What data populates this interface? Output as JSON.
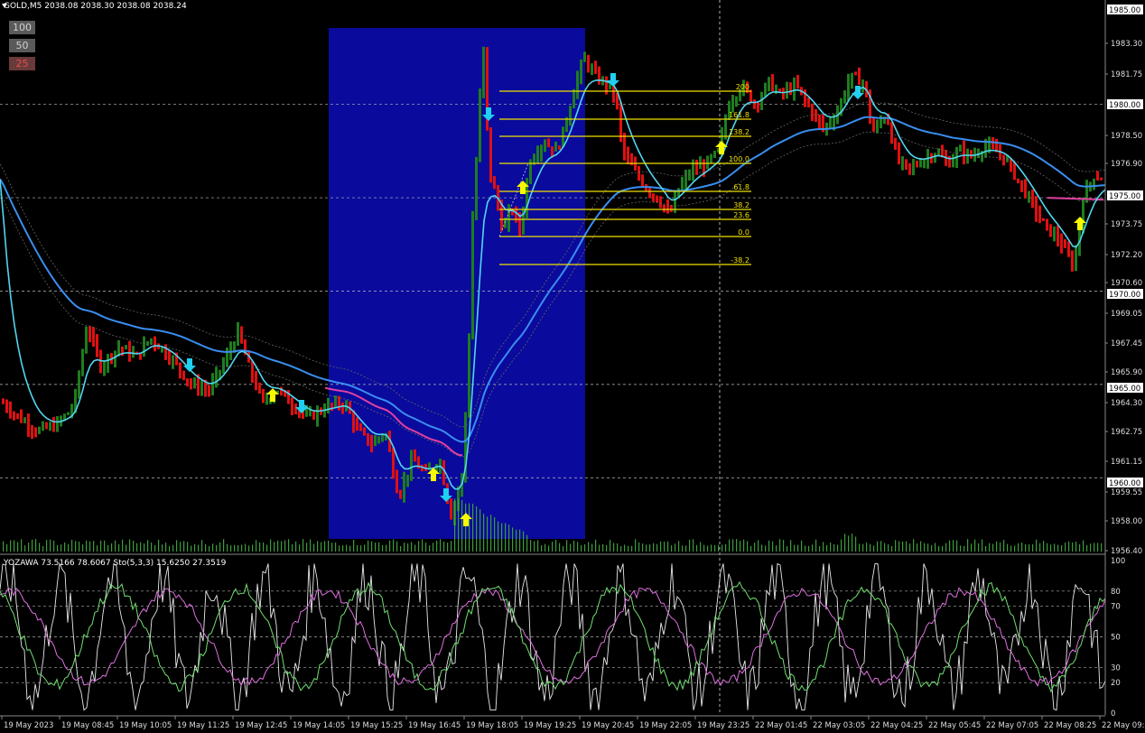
{
  "header": {
    "title": "GOLD,M5  2038.08 2038.30 2038.08 2038.24",
    "indicator_title": "YOZAWA 73.5166 78.6067  Sto(5,3,3) 15.6250 27.3519"
  },
  "zoom_buttons": [
    "100",
    "50",
    "25"
  ],
  "price_axis": {
    "labels": [
      "1985.00",
      "1983.30",
      "1981.75",
      "1980.00",
      "1978.50",
      "1976.90",
      "1975.00",
      "1973.75",
      "1972.20",
      "1970.60",
      "1970.00",
      "1969.05",
      "1967.45",
      "1965.90",
      "1965.00",
      "1964.30",
      "1962.75",
      "1961.15",
      "1960.00",
      "1959.55",
      "1958.00",
      "1956.40"
    ],
    "highlight": [
      "1985.00",
      "1980.00",
      "1975.00",
      "1970.00",
      "1965.00",
      "1960.00"
    ]
  },
  "indicator_axis": {
    "labels": [
      "100",
      "80",
      "70",
      "50",
      "30",
      "20",
      "0"
    ]
  },
  "time_axis": {
    "labels": [
      "19 May 2023",
      "19 May 08:45",
      "19 May 10:05",
      "19 May 11:25",
      "19 May 12:45",
      "19 May 14:05",
      "19 May 15:25",
      "19 May 16:45",
      "19 May 18:05",
      "19 May 19:25",
      "19 May 20:45",
      "19 May 22:05",
      "19 May 23:25",
      "22 May 01:45",
      "22 May 03:05",
      "22 May 04:25",
      "22 May 05:45",
      "22 May 07:05",
      "22 May 08:25",
      "22 May 09:4"
    ]
  },
  "fibo_levels": [
    "200",
    "161.8",
    "138.2",
    "100.0",
    "61.8",
    "38.2",
    "23.6",
    "0.0",
    "-38.2"
  ],
  "colors": {
    "background": "#000000",
    "bull": "#1e7d1e",
    "bear": "#e01010",
    "highlight_zone": "#0a0a9c",
    "fibo": "#f0e000",
    "ma_fast": "#52d5f0",
    "ma_slow": "#3a8ef0",
    "ma_mid": "#e040a0",
    "arrow_up": "#f8f800",
    "arrow_down": "#20d0f0"
  }
}
